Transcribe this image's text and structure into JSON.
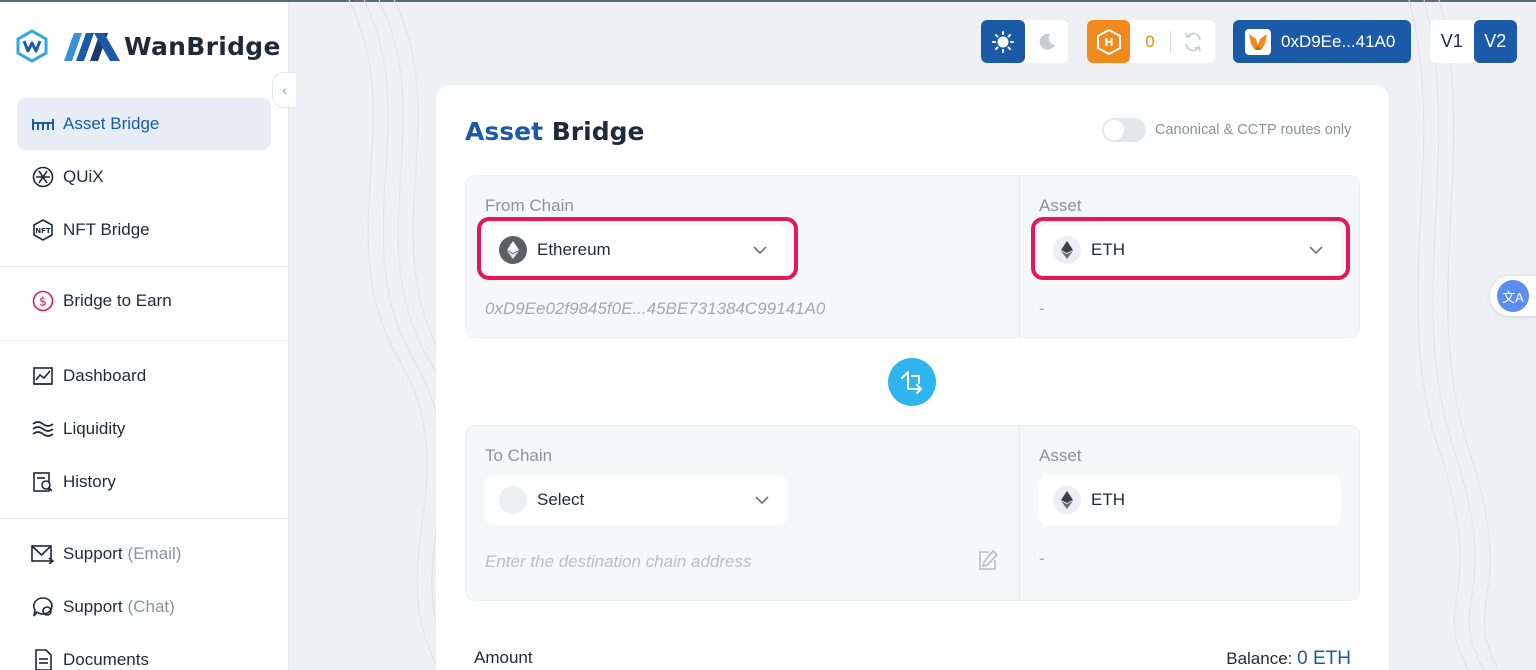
{
  "brand": {
    "name": "WanBridge"
  },
  "sidebar": {
    "items": [
      {
        "label": "Asset Bridge",
        "icon": "bridge-icon"
      },
      {
        "label": "QUiX",
        "icon": "quix-icon"
      },
      {
        "label": "NFT Bridge",
        "icon": "nft-icon"
      },
      {
        "label": "Bridge to Earn",
        "icon": "dollar-circle-icon"
      },
      {
        "label": "Dashboard",
        "icon": "dashboard-icon"
      },
      {
        "label": "Liquidity",
        "icon": "waves-icon"
      },
      {
        "label": "History",
        "icon": "history-icon"
      },
      {
        "label": "Support",
        "suffix": "(Email)",
        "icon": "email-icon"
      },
      {
        "label": "Support",
        "suffix": "(Chat)",
        "icon": "chat-icon"
      },
      {
        "label": "Documents",
        "icon": "document-icon"
      }
    ],
    "active_index": 0
  },
  "topbar": {
    "points_count": "0",
    "wallet_address": "0xD9Ee...41A0",
    "versions": [
      "V1",
      "V2"
    ],
    "active_version": "V2"
  },
  "card": {
    "title_part1": "Asset",
    "title_part2": "Bridge",
    "route_toggle_label": "Canonical & CCTP routes only",
    "route_toggle_on": false,
    "from": {
      "chain_label": "From Chain",
      "chain_value": "Ethereum",
      "asset_label": "Asset",
      "asset_value": "ETH",
      "address": "0xD9Ee02f9845f0E...45BE731384C99141A0",
      "asset_balance": "-"
    },
    "to": {
      "chain_label": "To Chain",
      "chain_value": "Select",
      "asset_label": "Asset",
      "asset_value": "ETH",
      "address_placeholder": "Enter the destination chain address",
      "asset_balance": "-"
    },
    "amount_label": "Amount",
    "balance_label": "Balance:",
    "balance_value": "0 ETH"
  },
  "colors": {
    "primary": "#1a5aa6",
    "accent_orange": "#f08a1c",
    "swap_blue": "#2fb5ee",
    "highlight_red": "#e5175a"
  }
}
